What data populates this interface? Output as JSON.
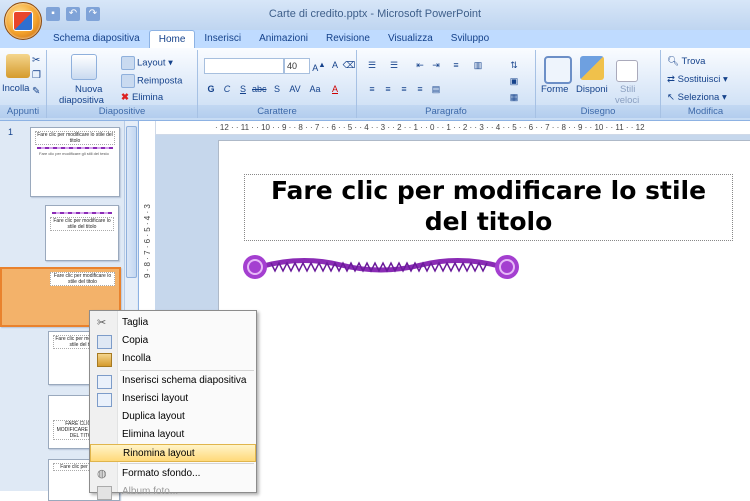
{
  "window": {
    "title": "Carte di credito.pptx - Microsoft PowerPoint"
  },
  "tabs": [
    {
      "label": "Schema diapositiva"
    },
    {
      "label": "Home"
    },
    {
      "label": "Inserisci"
    },
    {
      "label": "Animazioni"
    },
    {
      "label": "Revisione"
    },
    {
      "label": "Visualizza"
    },
    {
      "label": "Sviluppo"
    }
  ],
  "ribbon": {
    "clipboard": {
      "paste": "Incolla",
      "group": "Appunti"
    },
    "slides": {
      "new_slide_1": "Nuova",
      "new_slide_2": "diapositiva",
      "layout": "Layout",
      "reset": "Reimposta",
      "delete": "Elimina",
      "group": "Diapositive"
    },
    "font": {
      "size": "40",
      "group": "Carattere"
    },
    "paragraph": {
      "group": "Paragrafo"
    },
    "drawing": {
      "shapes": "Forme",
      "arrange": "Disponi",
      "quick_styles_1": "Stili",
      "quick_styles_2": "veloci",
      "group": "Disegno"
    },
    "editing": {
      "find": "Trova",
      "replace": "Sostituisci",
      "select": "Seleziona",
      "group": "Modifica"
    }
  },
  "ruler": {
    "horizontal": "· 12 · · 11 · · 10 · · 9 · · 8 · · 7 · · 6 · · 5 · · 4 · · 3 · · 2 · · 1 · · 0 · · 1 · · 2 · · 3 · · 4 · · 5 · · 6 · · 7 · · 8 · · 9 · · 10 · · 11 · · 12",
    "vertical": "9 · 8 · 7 · 6 · 5 · 4 · 3"
  },
  "thumbnails": {
    "first_number": "1",
    "master_title": "Fare clic per modificare lo stile del titolo",
    "master_body": "Fare clic per modificare gli stili del testo",
    "items": [
      {
        "title": "Fare clic per modificare lo stile del titolo"
      },
      {
        "title": "Fare clic per modificare lo stile del titolo"
      },
      {
        "title": "Fare clic per modificare lo stile del titolo"
      },
      {
        "title": "FARE CLIC PER MODIFICARE LO STILE DEL TITOLO"
      },
      {
        "title": "Fare clic per modifica"
      }
    ]
  },
  "slide": {
    "title": "Fare clic per modificare lo stile del titolo"
  },
  "context_menu": {
    "items": [
      {
        "label": "Taglia",
        "icon": "scissors-icon"
      },
      {
        "label": "Copia",
        "icon": "copy-icon"
      },
      {
        "label": "Incolla",
        "icon": "paste-icon"
      },
      {
        "label": "Inserisci schema diapositiva",
        "icon": "insert-master-icon"
      },
      {
        "label": "Inserisci layout",
        "icon": "insert-layout-icon"
      },
      {
        "label": "Duplica layout",
        "icon": ""
      },
      {
        "label": "Elimina layout",
        "icon": ""
      },
      {
        "label": "Rinomina layout",
        "icon": ""
      },
      {
        "label": "Formato sfondo...",
        "icon": "format-background-icon"
      },
      {
        "label": "Album foto...",
        "icon": "photo-album-icon"
      }
    ]
  },
  "colors": {
    "accent": "#8a2bb5",
    "ribbon": "#bfdbff",
    "hover": "#ffd97a"
  }
}
